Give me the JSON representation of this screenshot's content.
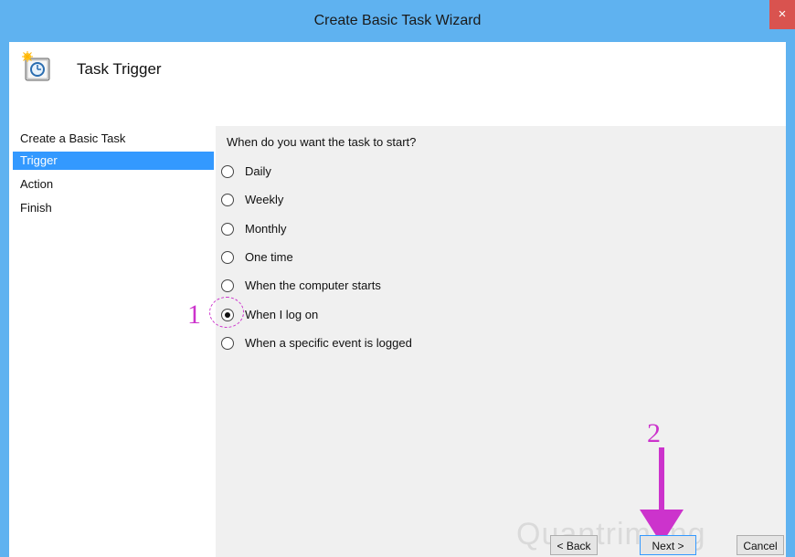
{
  "window": {
    "title": "Create Basic Task Wizard",
    "close_glyph": "×"
  },
  "header": {
    "title": "Task Trigger",
    "icon": "task-trigger-icon"
  },
  "nav": {
    "items": [
      {
        "label": "Create a Basic Task",
        "selected": false
      },
      {
        "label": "Trigger",
        "selected": true
      },
      {
        "label": "Action",
        "selected": false
      },
      {
        "label": "Finish",
        "selected": false
      }
    ]
  },
  "main": {
    "question": "When do you want the task to start?",
    "options": [
      {
        "label": "Daily",
        "checked": false
      },
      {
        "label": "Weekly",
        "checked": false
      },
      {
        "label": "Monthly",
        "checked": false
      },
      {
        "label": "One time",
        "checked": false
      },
      {
        "label": "When the computer starts",
        "checked": false
      },
      {
        "label": "When I log on",
        "checked": true
      },
      {
        "label": "When a specific event is logged",
        "checked": false
      }
    ]
  },
  "annotations": {
    "step1": "1",
    "step2": "2",
    "color": "#cc33cc"
  },
  "buttons": {
    "back": "< Back",
    "next": "Next >",
    "cancel": "Cancel"
  },
  "watermark": "Quantrimang"
}
